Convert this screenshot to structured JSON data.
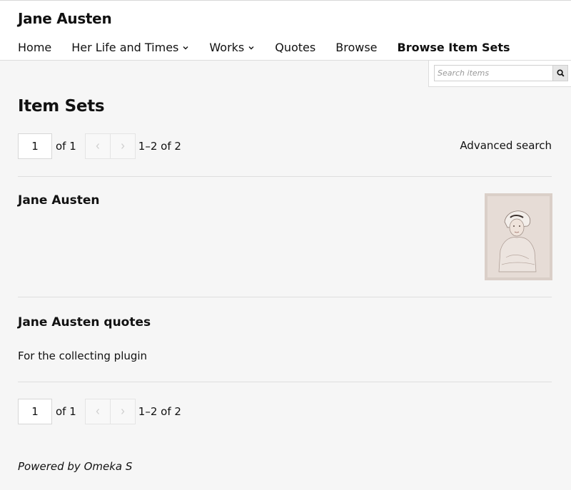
{
  "site": {
    "title": "Jane Austen"
  },
  "nav": {
    "items": [
      {
        "label": "Home"
      },
      {
        "label": "Her Life and Times"
      },
      {
        "label": "Works"
      },
      {
        "label": "Quotes"
      },
      {
        "label": "Browse"
      },
      {
        "label": "Browse Item Sets"
      }
    ]
  },
  "search": {
    "placeholder": "Search items"
  },
  "page": {
    "title": "Item Sets"
  },
  "pagination": {
    "current_page": "1",
    "of_label": "of 1",
    "range_label": "1–2 of 2"
  },
  "advanced_search_label": "Advanced search",
  "item_sets": [
    {
      "title": "Jane Austen",
      "description": ""
    },
    {
      "title": "Jane Austen quotes",
      "description": "For the collecting plugin"
    }
  ],
  "footer": {
    "text": "Powered by Omeka S"
  }
}
